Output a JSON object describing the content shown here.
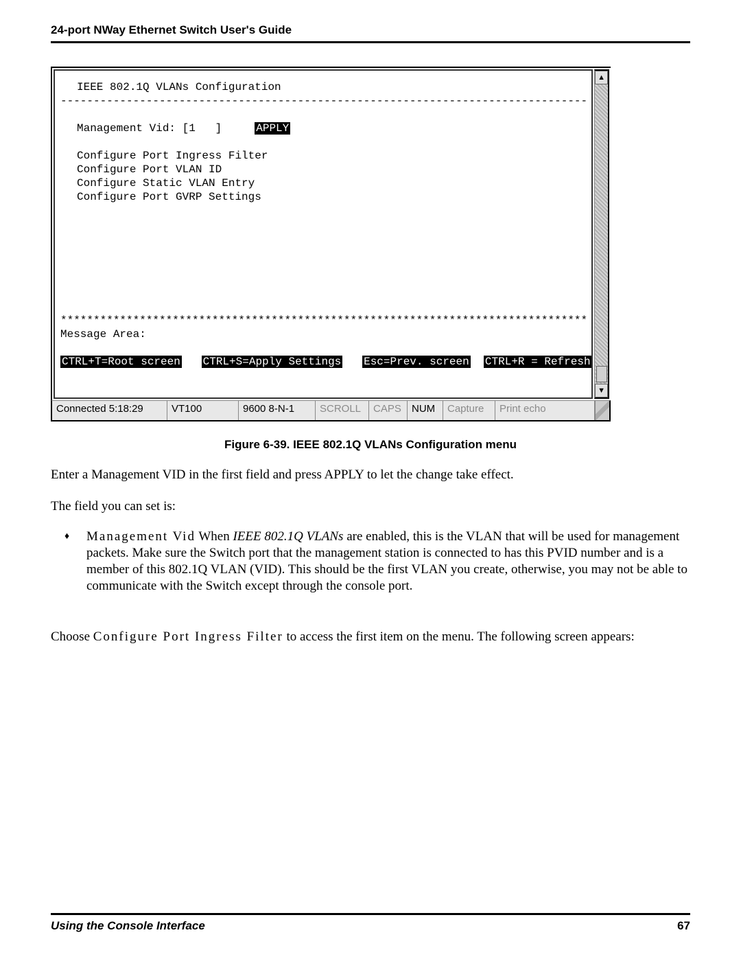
{
  "header": {
    "title": "24-port NWay Ethernet Switch User's Guide"
  },
  "terminal": {
    "title": "IEEE 802.1Q VLANs Configuration",
    "dashes": "--------------------------------------------------------------------------------",
    "mgmt_label": "Management Vid: [1   ]",
    "apply": "APPLY",
    "menu": [
      "Configure Port Ingress Filter",
      "Configure Port VLAN ID",
      "Configure Static VLAN Entry",
      "Configure Port GVRP Settings"
    ],
    "stars": "********************************************************************************",
    "msg_area": "Message Area:",
    "hint_root": "CTRL+T=Root screen",
    "hint_apply": "CTRL+S=Apply Settings",
    "hint_prev": "Esc=Prev. screen",
    "hint_refresh": "CTRL+R = Refresh",
    "scroll_up": "▲",
    "scroll_down": "▼"
  },
  "statusbar": {
    "conn": "Connected 5:18:29",
    "emu": "VT100",
    "serial": "9600 8-N-1",
    "scroll": "SCROLL",
    "caps": "CAPS",
    "num": "NUM",
    "capture": "Capture",
    "printecho": "Print echo"
  },
  "caption": "Figure 6-39.  IEEE 802.1Q VLANs Configuration menu",
  "para1": "Enter a Management VID in the first field and press APPLY to let the change take effect.",
  "para2": "The field you can set is:",
  "bullet": {
    "label": "Management Vid",
    "text_a": "  When ",
    "emph": "IEEE 802.1Q VLANs",
    "text_b": " are enabled, this is the VLAN that will be used for management packets. Make sure the Switch port that the management station is connected to has this PVID number and is a member of this 802.1Q VLAN (VID). This should be the first VLAN you create, otherwise, you may not be able to communicate with the Switch except through the console port."
  },
  "para3": {
    "a": "Choose ",
    "emph": "Configure Port Ingress Filter",
    "b": " to access the first item on the menu. The following screen appears:"
  },
  "footer": {
    "section": "Using the Console Interface",
    "page": "67"
  }
}
